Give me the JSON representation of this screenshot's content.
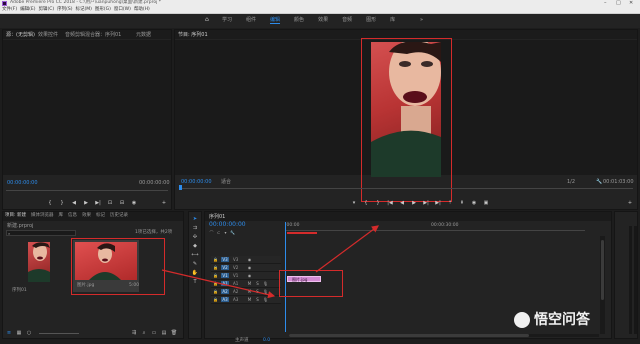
{
  "titlebar": {
    "title": "Adobe Premiere Pro CC 2018 - C:\\用户\\uanpuhong\\桌面\\新建.prproj *"
  },
  "menu": [
    "文件(F)",
    "编辑(E)",
    "剪辑(C)",
    "序列(S)",
    "标记(M)",
    "图形(G)",
    "窗口(W)",
    "帮助(H)"
  ],
  "workspaces": [
    "学习",
    "组件",
    "编辑",
    "颜色",
    "效果",
    "音频",
    "图形",
    "库"
  ],
  "active_workspace": "编辑",
  "source_panel": {
    "tabs": [
      "源：(无剪辑)",
      "效果控件",
      "音频剪辑混合器：序列01",
      "元数据"
    ],
    "timecode_left": "00:00:00:00",
    "timecode_right": "00:00:00:00"
  },
  "program_panel": {
    "tab": "节目: 序列01",
    "timecode": "00:00:00:00",
    "fit": "适合",
    "ratio": "1/2",
    "duration": "00:01:03:00"
  },
  "project_panel": {
    "tabs": [
      "项目: 新建",
      "媒体浏览器",
      "库",
      "信息",
      "效果",
      "标记",
      "历史记录"
    ],
    "path": "新建.prproj",
    "count": "1项已选择，共2项",
    "items": [
      {
        "name": "序列01",
        "duration": ""
      },
      {
        "name": "图片.jpg",
        "duration": "5:00"
      }
    ]
  },
  "timeline": {
    "tab": "序列01",
    "timecode": "00:00:00:00",
    "ruler_start": ":00:00",
    "ruler_mid": "00:00:30:00",
    "video_tracks": [
      "V3",
      "V2",
      "V1"
    ],
    "audio_tracks": [
      "A1",
      "A2",
      "A3"
    ],
    "master_label": "主声道",
    "master_value": "0.0",
    "clip_label": "图片.jpg"
  },
  "watermark": {
    "text": "悟空问答"
  },
  "colors": {
    "accent_blue": "#2d8ceb",
    "annotation_red": "#d42b2b",
    "clip_pink": "#d38bd3"
  }
}
